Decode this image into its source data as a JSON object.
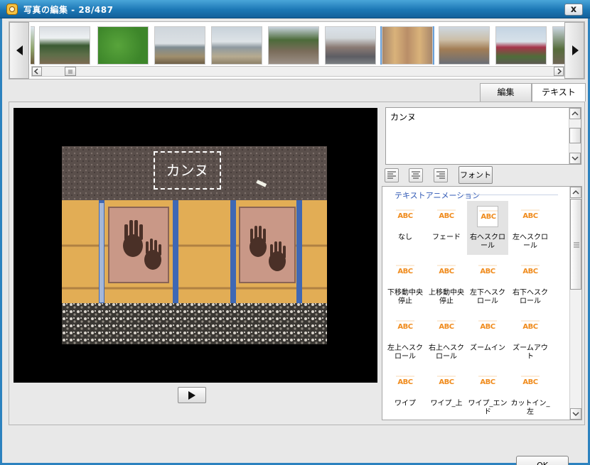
{
  "window": {
    "title": "写真の編集 - 28/487",
    "close_label": "x"
  },
  "thumbnails": [
    {
      "name": "palm-trees",
      "selected": false
    },
    {
      "name": "grass",
      "selected": false
    },
    {
      "name": "pier",
      "selected": false
    },
    {
      "name": "sea-shore",
      "selected": false
    },
    {
      "name": "street-palms",
      "selected": false
    },
    {
      "name": "building-plaza",
      "selected": false
    },
    {
      "name": "handprint-tiles",
      "selected": true
    },
    {
      "name": "apartment-building",
      "selected": false
    },
    {
      "name": "harbor-flags",
      "selected": false
    }
  ],
  "tabs": [
    {
      "label": "編集",
      "active": false
    },
    {
      "label": "テキスト",
      "active": true
    }
  ],
  "preview": {
    "caption": "カンヌ"
  },
  "text_editor": {
    "value": "カンヌ",
    "font_button": "フォント"
  },
  "animations": {
    "group_label": "テキストアニメーション",
    "items": [
      {
        "label": "なし",
        "selected": false
      },
      {
        "label": "フェード",
        "selected": false
      },
      {
        "label": "右へスクロール",
        "selected": true
      },
      {
        "label": "左へスクロール",
        "selected": false
      },
      {
        "label": "下移動中央停止",
        "selected": false
      },
      {
        "label": "上移動中央停止",
        "selected": false
      },
      {
        "label": "左下へスクロール",
        "selected": false
      },
      {
        "label": "右下へスクロール",
        "selected": false
      },
      {
        "label": "左上へスクロール",
        "selected": false
      },
      {
        "label": "右上へスクロール",
        "selected": false
      },
      {
        "label": "ズームイン",
        "selected": false
      },
      {
        "label": "ズームアウト",
        "selected": false
      },
      {
        "label": "ワイプ",
        "selected": false
      },
      {
        "label": "ワイプ_上",
        "selected": false
      },
      {
        "label": "ワイプ_エンド",
        "selected": false
      },
      {
        "label": "カットイン_左",
        "selected": false
      }
    ]
  },
  "ok_button": "OK",
  "colors": {
    "title_bar": "#1c77b5",
    "anim_label": "#2f58b5",
    "abc_icon": "#f08c1e"
  }
}
